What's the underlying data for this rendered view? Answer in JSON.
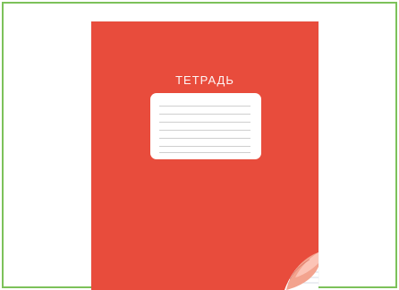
{
  "notebook": {
    "cover_title": "ТЕТРАДЬ",
    "cover_color": "#e84c3c",
    "label_box": {
      "has_lines": true
    }
  },
  "frame": {
    "border_color": "#7cc15a"
  }
}
